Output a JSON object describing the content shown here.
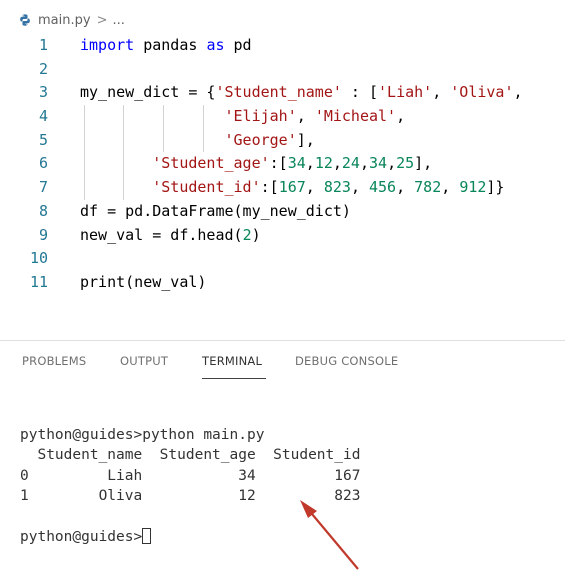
{
  "breadcrumb": {
    "file_icon": "python-file-icon",
    "file_name": "main.py",
    "separator": ">",
    "more": "..."
  },
  "editor": {
    "lines": [
      {
        "number": "1",
        "text": "import pandas as pd"
      },
      {
        "number": "2",
        "text": ""
      },
      {
        "number": "3",
        "text": "my_new_dict = {'Student_name' : ['Liah', 'Oliva',"
      },
      {
        "number": "4",
        "text": "                'Elijah', 'Micheal',"
      },
      {
        "number": "5",
        "text": "                'George'],"
      },
      {
        "number": "6",
        "text": "        'Student_age':[34,12,24,34,25],"
      },
      {
        "number": "7",
        "text": "        'Student_id':[167, 823, 456, 782, 912]}"
      },
      {
        "number": "8",
        "text": "df = pd.DataFrame(my_new_dict)"
      },
      {
        "number": "9",
        "text": "new_val = df.head(2)"
      },
      {
        "number": "10",
        "text": ""
      },
      {
        "number": "11",
        "text": "print(new_val)"
      }
    ]
  },
  "panel": {
    "tabs": [
      {
        "label": "PROBLEMS",
        "active": false
      },
      {
        "label": "OUTPUT",
        "active": false
      },
      {
        "label": "TERMINAL",
        "active": true
      },
      {
        "label": "DEBUG CONSOLE",
        "active": false
      }
    ]
  },
  "terminal": {
    "lines": [
      "",
      "python@guides>python main.py",
      "  Student_name  Student_age  Student_id",
      "0         Liah           34         167",
      "1        Oliva           12         823",
      "",
      "python@guides>"
    ]
  },
  "colors": {
    "keyword": "#0000ff",
    "string": "#a31515",
    "number": "#098658",
    "line_number": "#237893",
    "annotation_arrow": "#c0392b"
  }
}
